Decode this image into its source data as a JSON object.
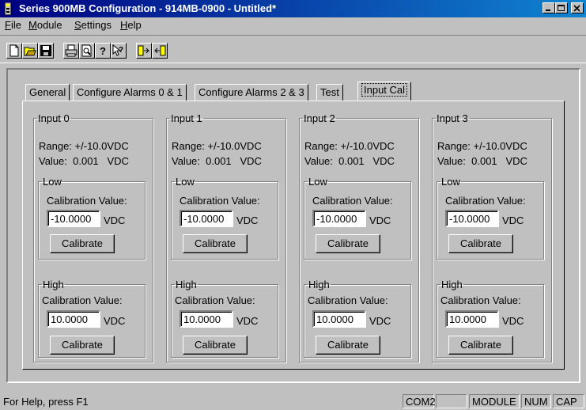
{
  "window": {
    "title": "Series 900MB Configuration - 914MB-0900 - Untitled*"
  },
  "menu": [
    {
      "label": "File",
      "key": "F",
      "rest": "ile"
    },
    {
      "label": "Module",
      "key": "M",
      "rest": "odule"
    },
    {
      "label": "Settings",
      "key": "S",
      "rest": "ettings"
    },
    {
      "label": "Help",
      "key": "H",
      "rest": "elp"
    }
  ],
  "toolbar": [
    "new-icon",
    "open-icon",
    "save-icon",
    "print-icon",
    "print-preview-icon",
    "help-icon",
    "context-help-icon",
    "download-icon",
    "upload-icon"
  ],
  "tabs": [
    "General",
    "Configure Alarms 0 & 1",
    "Configure Alarms 2 & 3",
    "Test",
    "Input Cal"
  ],
  "active_tab": "Input Cal",
  "inputs": [
    {
      "title": "Input 0",
      "range": "Range: +/-10.0VDC",
      "value": "Value:  0.001   VDC",
      "low": {
        "title": "Low",
        "cal_label": "Calibration Value:",
        "cal_value": "-10.0000",
        "unit": "VDC",
        "button": "Calibrate"
      },
      "high": {
        "title": "High",
        "cal_label": "Calibration Value:",
        "cal_value": "10.0000",
        "unit": "VDC",
        "button": "Calibrate"
      }
    },
    {
      "title": "Input 1",
      "range": "Range: +/-10.0VDC",
      "value": "Value:  0.001   VDC",
      "low": {
        "title": "Low",
        "cal_label": "Calibration Value:",
        "cal_value": "-10.0000",
        "unit": "VDC",
        "button": "Calibrate"
      },
      "high": {
        "title": "High",
        "cal_label": "Calibration Value:",
        "cal_value": "10.0000",
        "unit": "VDC",
        "button": "Calibrate"
      }
    },
    {
      "title": "Input 2",
      "range": "Range: +/-10.0VDC",
      "value": "Value:  0.001   VDC",
      "low": {
        "title": "Low",
        "cal_label": "Calibration Value:",
        "cal_value": "-10.0000",
        "unit": "VDC",
        "button": "Calibrate"
      },
      "high": {
        "title": "High",
        "cal_label": "Calibration Value:",
        "cal_value": "10.0000",
        "unit": "VDC",
        "button": "Calibrate"
      }
    },
    {
      "title": "Input 3",
      "range": "Range: +/-10.0VDC",
      "value": "Value:  0.001   VDC",
      "low": {
        "title": "Low",
        "cal_label": "Calibration Value:",
        "cal_value": "-10.0000",
        "unit": "VDC",
        "button": "Calibrate"
      },
      "high": {
        "title": "High",
        "cal_label": "Calibration Value:",
        "cal_value": "10.0000",
        "unit": "VDC",
        "button": "Calibrate"
      }
    }
  ],
  "status": {
    "help": "For Help, press F1",
    "port": "COM2",
    "blank": "",
    "module": "MODULE",
    "num": "NUM",
    "cap": "CAP"
  },
  "colors": {
    "title_start": "#000080",
    "title_end": "#1084d0",
    "face": "#c0c0c0"
  }
}
